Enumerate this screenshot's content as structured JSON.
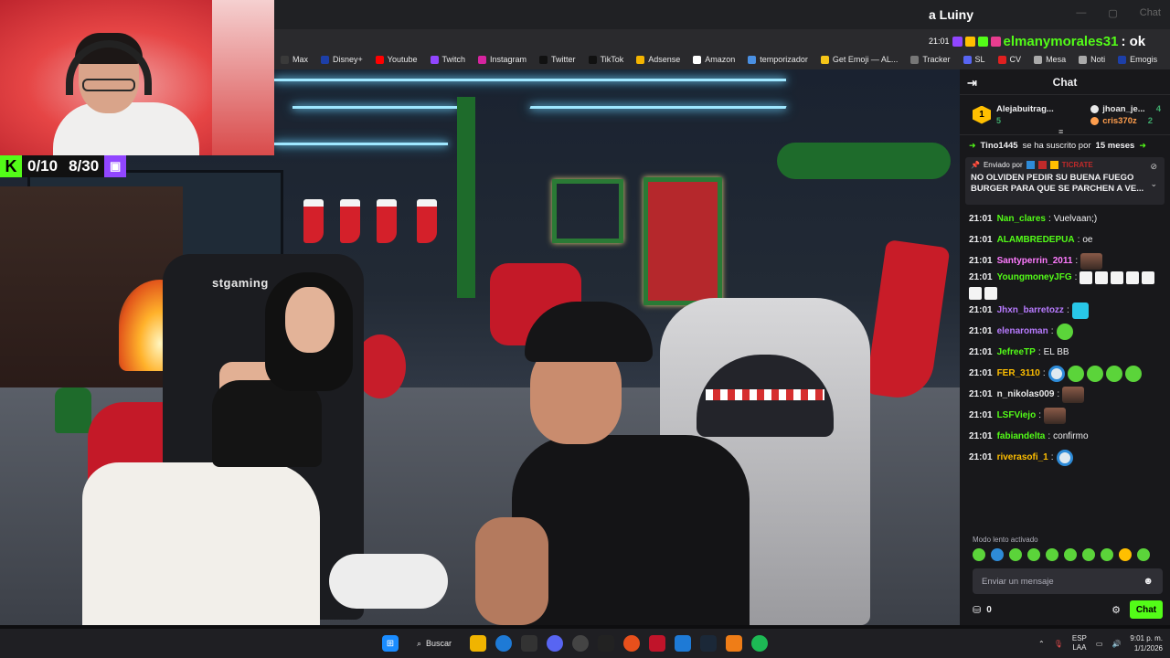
{
  "browser": {
    "bookmarks": [
      {
        "label": "Max",
        "color": "#3a3a3a"
      },
      {
        "label": "Disney+",
        "color": "#1d3fa8"
      },
      {
        "label": "Youtube",
        "color": "#ff0000"
      },
      {
        "label": "Twitch",
        "color": "#9146ff"
      },
      {
        "label": "Instagram",
        "color": "#d6249f"
      },
      {
        "label": "Twitter",
        "color": "#111111"
      },
      {
        "label": "TikTok",
        "color": "#111111"
      },
      {
        "label": "Adsense",
        "color": "#f4b400"
      },
      {
        "label": "Amazon",
        "color": "#ffffff"
      },
      {
        "label": "temporizador",
        "color": "#4a90e2"
      },
      {
        "label": "Get Emoji — AL...",
        "color": "#f5c518"
      },
      {
        "label": "Tracker",
        "color": "#777777"
      },
      {
        "label": "SL",
        "color": "#5865f2"
      },
      {
        "label": "CV",
        "color": "#e02020"
      },
      {
        "label": "Mesa",
        "color": "#aaaaaa"
      },
      {
        "label": "Noti",
        "color": "#aaaaaa"
      },
      {
        "label": "Emogis",
        "color": "#1d3fa8"
      }
    ],
    "more_label": "›",
    "window_label": "Chat"
  },
  "overlay": {
    "kick_logo": "K",
    "counter_1": "0/10",
    "counter_2": "8/30",
    "twitch_logo": "▣"
  },
  "stream": {
    "title": "a Luiny",
    "ticker_time": "21:01",
    "ticker_user": "elmanymorales31",
    "ticker_rest": ": ok",
    "chair_brand": "stgaming"
  },
  "chat": {
    "header_title": "Chat",
    "collapse_icon": "⇥",
    "leaderboard": {
      "rank": "1",
      "top_name": "Alejabuitrag...",
      "top_pts": "5",
      "row1_name": "jhoan_je...",
      "row1_val": "4",
      "row2_name": "cris370z",
      "row2_val": "2"
    },
    "sub_notice": {
      "user": "Tino1445",
      "mid": " se ha suscrito por ",
      "months": "15 meses"
    },
    "pinned": {
      "sent_by": "Enviado por",
      "sender": "TICRATE",
      "text": "NO OLVIDEN PEDIR SU BUENA FUEGO BURGER PARA QUE SE PARCHEN A VE..."
    },
    "messages": [
      {
        "time": "21:01",
        "user": "Nan_clares",
        "color": "#53fc18",
        "text": "Vuelvaan;)",
        "emotes": []
      },
      {
        "time": "21:01",
        "user": "ALAMBREDEPUA",
        "color": "#53fc18",
        "text": "oe",
        "emotes": []
      },
      {
        "time": "21:01",
        "user": "Santyperrin_2011",
        "color": "#ff7bff",
        "text": "",
        "emotes": [
          "face"
        ]
      },
      {
        "time": "21:01",
        "user": "YoungmoneyJFG",
        "color": "#53fc18",
        "text": "",
        "emotes": [
          "spk",
          "spk",
          "spk",
          "spk",
          "spk",
          "spk",
          "spk"
        ]
      },
      {
        "time": "21:01",
        "user": "Jhxn_barretozz",
        "color": "#b87bff",
        "text": "",
        "emotes": [
          "cyan"
        ]
      },
      {
        "time": "21:01",
        "user": "elenaroman",
        "color": "#b87bff",
        "text": "",
        "emotes": [
          "green"
        ]
      },
      {
        "time": "21:01",
        "user": "JefreeTP",
        "color": "#53fc18",
        "text": "EL BB",
        "emotes": []
      },
      {
        "time": "21:01",
        "user": "FER_3110",
        "color": "#ffbf00",
        "text": "",
        "emotes": [
          "ghost",
          "green",
          "green",
          "green",
          "green"
        ]
      },
      {
        "time": "21:01",
        "user": "n_nikolas009",
        "color": "#e8e8e8",
        "text": "",
        "emotes": [
          "face"
        ]
      },
      {
        "time": "21:01",
        "user": "LSFViejo",
        "color": "#53fc18",
        "text": "",
        "emotes": [
          "face"
        ]
      },
      {
        "time": "21:01",
        "user": "fabiandelta",
        "color": "#53fc18",
        "text": "confirmo",
        "emotes": []
      },
      {
        "time": "21:01",
        "user": "riverasofi_1",
        "color": "#ffbf00",
        "text": "",
        "emotes": [
          "ghost"
        ]
      }
    ],
    "slow_mode": "Modo lento activado",
    "input_placeholder": "Enviar un mensaje",
    "points": "0",
    "send_label": "Chat"
  },
  "taskbar": {
    "search_label": "Buscar",
    "lang_1": "ESP",
    "lang_2": "LAA",
    "time": "9:01 p. m.",
    "date": "1/1/2026"
  }
}
